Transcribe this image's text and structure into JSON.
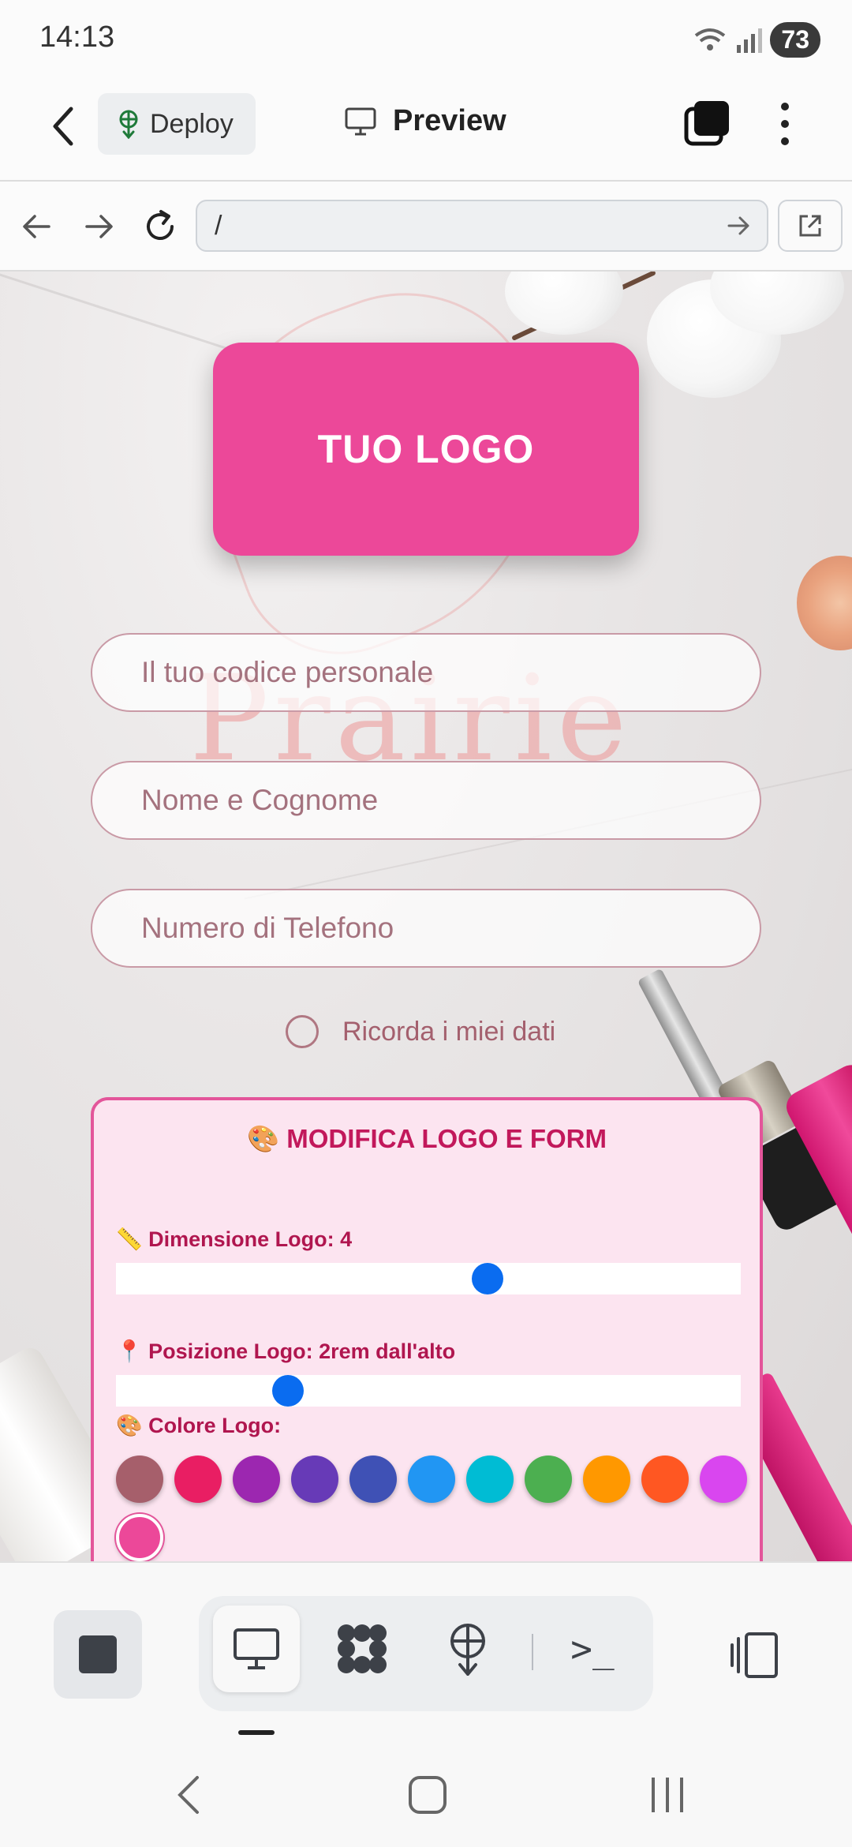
{
  "status": {
    "time": "14:13",
    "battery": "73"
  },
  "appbar": {
    "deploy_label": "Deploy",
    "title": "Preview"
  },
  "urlbar": {
    "url": "/"
  },
  "page": {
    "logo_text": "TUO LOGO",
    "background_text": "Prairie",
    "fields": [
      {
        "placeholder": "Il tuo codice personale"
      },
      {
        "placeholder": "Nome e Cognome"
      },
      {
        "placeholder": "Numero di Telefono"
      }
    ],
    "remember_label": "Ricorda i miei dati",
    "panel": {
      "title": "🎨 MODIFICA LOGO E FORM",
      "size_label": "📏 Dimensione Logo: 4",
      "size_value_fraction": 0.595,
      "position_label": "📍 Posizione Logo: 2rem dall'alto",
      "position_value_fraction": 0.275,
      "color_label": "🎨 Colore Logo:",
      "colors": [
        "#a65f6b",
        "#e91e63",
        "#9c27b0",
        "#673ab7",
        "#3f51b5",
        "#2196f3",
        "#00bcd4",
        "#4caf50",
        "#ff9800",
        "#ff5722",
        "#d946ef",
        "#ec4899"
      ],
      "selected_color": "#ec4899"
    }
  },
  "bottombar": {
    "icons": [
      "stop-icon",
      "desktop-icon",
      "network-icon",
      "deploy-icon",
      "terminal-icon",
      "panel-toggle-icon"
    ],
    "terminal_glyph": ">_"
  }
}
